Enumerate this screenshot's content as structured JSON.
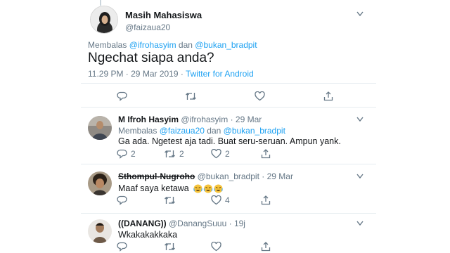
{
  "main_tweet": {
    "name": "Masih Mahasiswa",
    "handle": "@faizaua20",
    "replying_label": "Membalas",
    "replying_user1": "@ifrohasyim",
    "replying_and": "dan",
    "replying_user2": "@bukan_bradpit",
    "text": "Ngechat siapa anda?",
    "time": "11.29 PM · 29 Mar 2019 ·",
    "source": "Twitter for Android"
  },
  "replies": [
    {
      "name": "M Ifroh Hasyim",
      "handle": "@ifrohasyim",
      "dot": "·",
      "date": "29 Mar",
      "replying_label": "Membalas",
      "replying_user1": "@faizaua20",
      "replying_and": "dan",
      "replying_user2": "@bukan_bradpit",
      "text": "Ga ada. Ngetest aja tadi. Buat seru-seruan. Ampun yank.",
      "reply_count": "2",
      "retweet_count": "2",
      "like_count": "2"
    },
    {
      "name": "Sthompul-Nugroho",
      "handle": "@bukan_bradpit",
      "dot": "·",
      "date": "29 Mar",
      "text": "Maaf saya ketawa",
      "reply_count": "",
      "retweet_count": "",
      "like_count": "4"
    },
    {
      "name": "((DANANG))",
      "handle": "@DanangSuuu",
      "dot": "·",
      "date": "19j",
      "text": "Wkakakakkaka",
      "reply_count": "",
      "retweet_count": "",
      "like_count": ""
    }
  ],
  "icons": [
    "reply-icon",
    "retweet-icon",
    "like-icon",
    "share-icon",
    "chevron-down-icon",
    "laughing-emoji-icon"
  ],
  "colors": {
    "link": "#1da1f2",
    "grey": "#657786",
    "border": "#e6ecf0"
  }
}
